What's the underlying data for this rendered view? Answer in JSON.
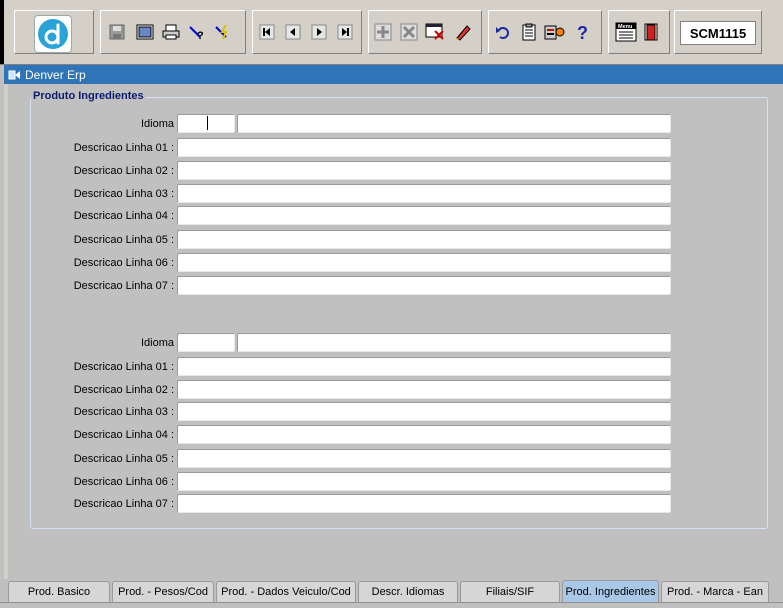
{
  "toolbar": {
    "form_code": "SCM1115",
    "buttons": [
      "save-icon",
      "window-icon",
      "print-icon",
      "query-help-icon",
      "execute-query-icon",
      "first-record-icon",
      "previous-record-icon",
      "next-record-icon",
      "last-record-icon",
      "insert-record-icon",
      "delete-record-icon",
      "clear-record-icon",
      "edit-icon",
      "undo-icon",
      "clipboard-icon",
      "tools-icon",
      "help-icon",
      "menu-icon",
      "exit-icon"
    ],
    "menu_icon_text": "Menu"
  },
  "window": {
    "title": "Denver Erp"
  },
  "section": {
    "title": "Produto Ingredientes",
    "blocks": [
      {
        "idioma_label": "Idioma",
        "idioma_code": "",
        "idioma_desc": "",
        "lines": [
          {
            "label": "Descricao Linha 01 :",
            "value": ""
          },
          {
            "label": "Descricao Linha 02 :",
            "value": ""
          },
          {
            "label": "Descricao Linha 03 :",
            "value": ""
          },
          {
            "label": "Descricao Linha 04 :",
            "value": ""
          },
          {
            "label": "Descricao Linha 05 :",
            "value": ""
          },
          {
            "label": "Descricao Linha 06 :",
            "value": ""
          },
          {
            "label": "Descricao Linha 07 :",
            "value": ""
          }
        ]
      },
      {
        "idioma_label": "Idioma",
        "idioma_code": "",
        "idioma_desc": "",
        "lines": [
          {
            "label": "Descricao Linha 01 :",
            "value": ""
          },
          {
            "label": "Descricao Linha 02 :",
            "value": ""
          },
          {
            "label": "Descricao Linha 03 :",
            "value": ""
          },
          {
            "label": "Descricao Linha 04 :",
            "value": ""
          },
          {
            "label": "Descricao Linha 05 :",
            "value": ""
          },
          {
            "label": "Descricao Linha 06 :",
            "value": ""
          },
          {
            "label": "Descricao Linha 07 :",
            "value": ""
          }
        ]
      }
    ]
  },
  "tabs": [
    {
      "label": "Prod. Basico",
      "active": false
    },
    {
      "label": "Prod. - Pesos/Cod",
      "active": false
    },
    {
      "label": "Prod. - Dados Veiculo/Cod",
      "active": false
    },
    {
      "label": "Descr. Idiomas",
      "active": false
    },
    {
      "label": "Filiais/SIF",
      "active": false
    },
    {
      "label": "Prod. Ingredientes",
      "active": true
    },
    {
      "label": "Prod. - Marca - Ean",
      "active": false
    }
  ],
  "colors": {
    "titlebar": "#2f74b7",
    "active_tab": "#a9c8e8",
    "group_title": "#0d1a6e",
    "logo": "#2aa3d6"
  }
}
